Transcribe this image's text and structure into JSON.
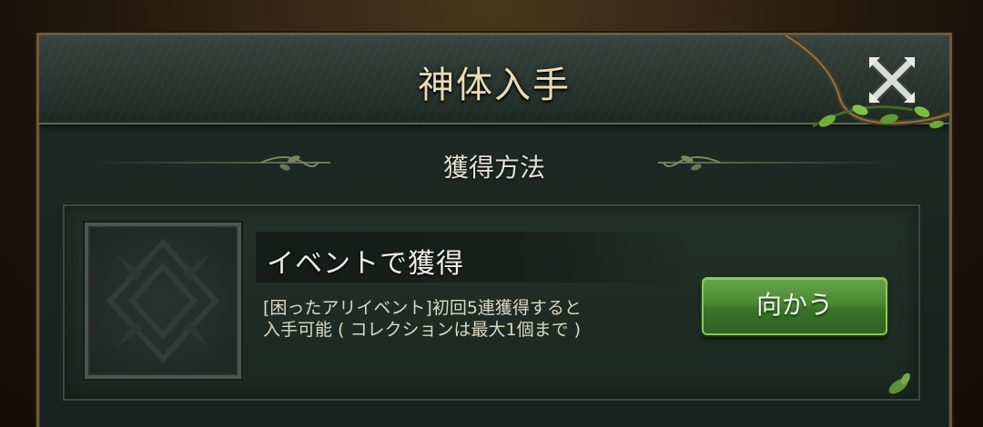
{
  "dialog": {
    "title": "神体入手",
    "close_icon": "close-x-icon"
  },
  "section": {
    "title": "獲得方法"
  },
  "source": {
    "title": "イベントで獲得",
    "description": "[困ったアリイベント]初回5連獲得すると\n入手可能 ( コレクションは最大1個まで )",
    "go_button_label": "向かう",
    "slot_icon": "empty-slot-emblem-icon"
  },
  "colors": {
    "accent_green": "#4a8a33",
    "title_text": "#eadcb6",
    "panel_bg": "#1f2b26",
    "frame_gold": "#6b5a3a"
  }
}
